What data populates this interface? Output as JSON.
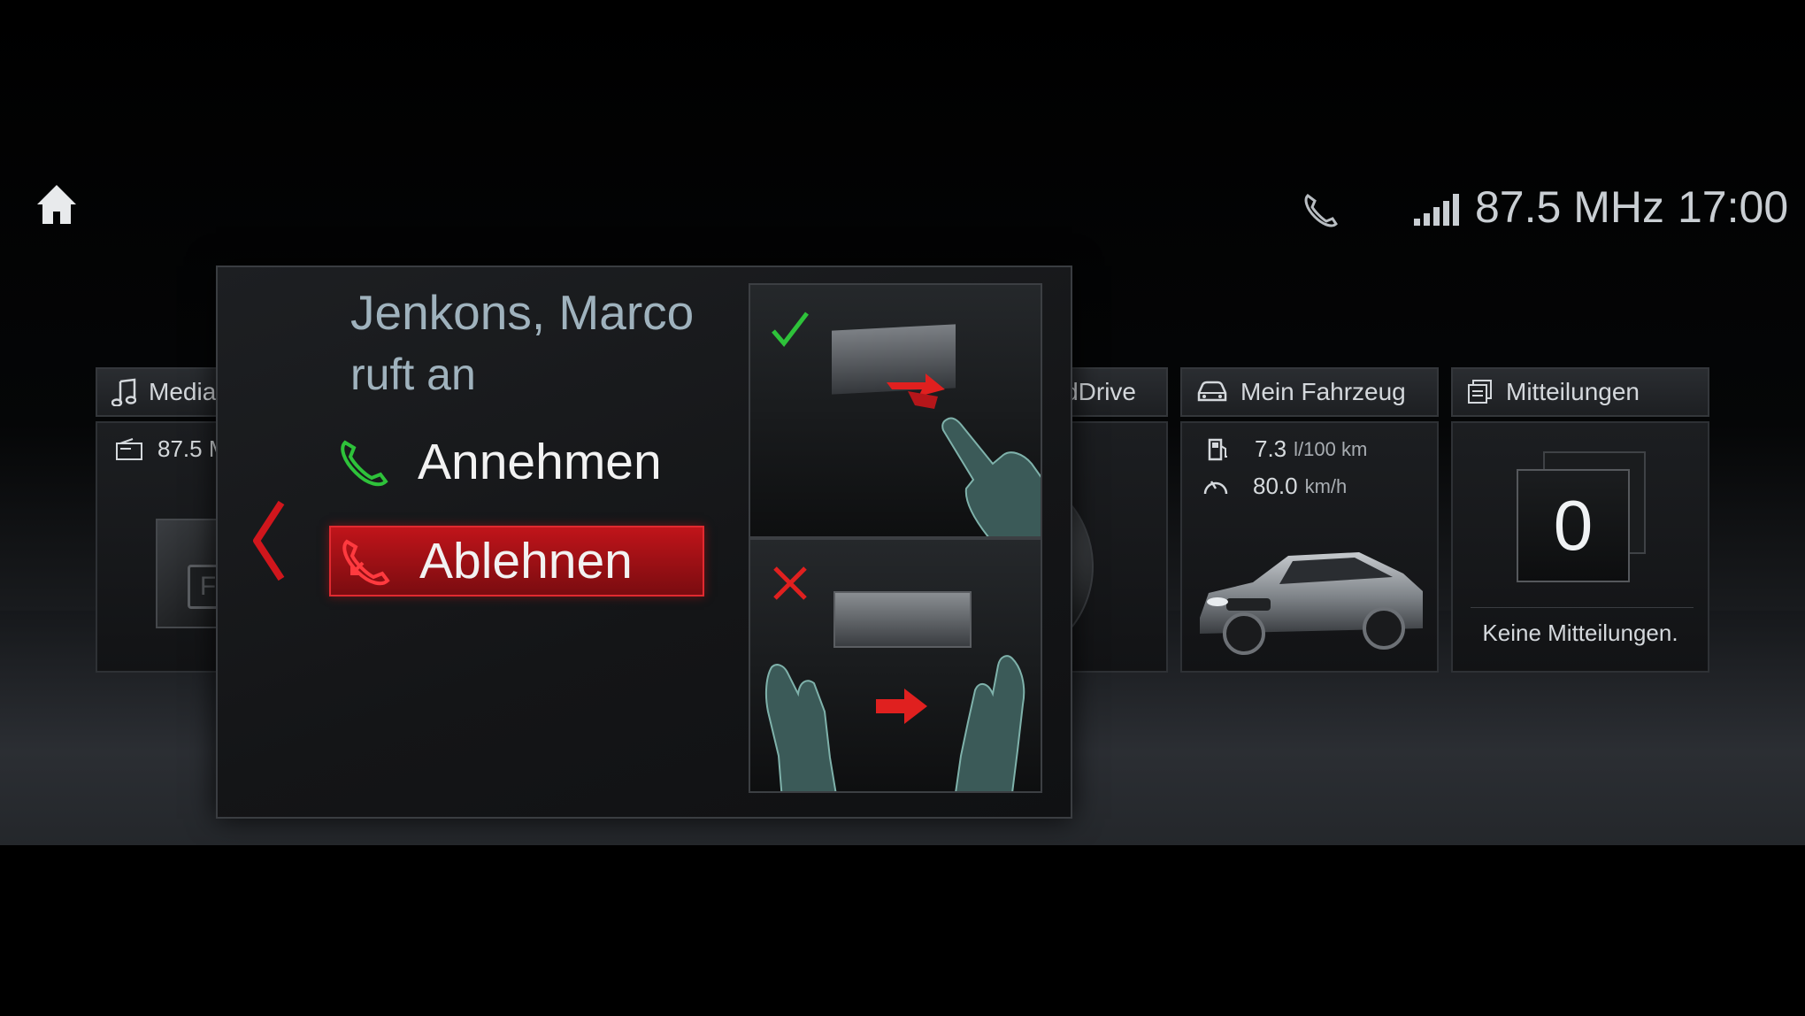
{
  "status_bar": {
    "radio_frequency": "87.5 MHz",
    "clock": "17:00"
  },
  "tiles": {
    "media": {
      "title": "Media",
      "station": "87.5 M",
      "preset_letter": "F"
    },
    "connected_drive": {
      "title": "dDrive"
    },
    "vehicle": {
      "title": "Mein Fahrzeug",
      "consumption_value": "7.3",
      "consumption_unit": "l/100 km",
      "speed_value": "80.0",
      "speed_unit": "km/h"
    },
    "messages": {
      "title": "Mitteilungen",
      "count": "0",
      "empty_text": "Keine Mitteilungen."
    }
  },
  "call_popup": {
    "caller_name": "Jenkons, Marco",
    "caller_status": "ruft an",
    "accept_label": "Annehmen",
    "decline_label": "Ablehnen"
  },
  "colors": {
    "accent_red": "#c0141a",
    "accept_green": "#2ec23a",
    "text_light": "#d4d8dc"
  },
  "icons": [
    "home-icon",
    "phone-status-icon",
    "signal-bars-icon",
    "music-note-icon",
    "radio-icon",
    "car-icon",
    "messages-icon",
    "fuel-pump-icon",
    "speedometer-icon",
    "phone-accept-icon",
    "phone-decline-icon",
    "back-chevron-icon",
    "checkmark-icon",
    "cross-icon",
    "arrow-right-icon"
  ]
}
